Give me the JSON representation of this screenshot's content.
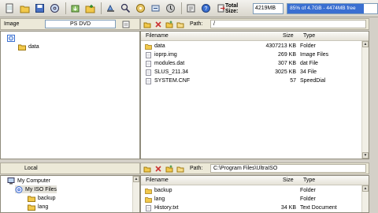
{
  "toolbar": {
    "buttons": [
      "new-icon",
      "open-icon",
      "save-icon",
      "save-as-icon",
      "extract-icon",
      "add-files-icon",
      "add-dir-icon",
      "delete-icon",
      "burn-icon",
      "mount-icon",
      "compress-icon",
      "properties-icon",
      "help-icon",
      "exit-icon"
    ],
    "total_size_label": "Total Size:",
    "total_size_value": "4219MB",
    "capacity_text": "85% of 4.7GB - 4474MB free",
    "capacity_fraction": 0.85,
    "accent_color": "#3a6fd1"
  },
  "iso_pane": {
    "image_label": "Image",
    "image_name": "PS DVD",
    "path_label": "Path:",
    "path_value": "/",
    "columns": {
      "filename": "Filename",
      "size": "Size",
      "type": "Type"
    },
    "tree": [
      {
        "label": "",
        "icon": "disc-icon"
      },
      {
        "label": "data",
        "icon": "folder-icon"
      }
    ],
    "files": [
      {
        "name": "data",
        "size": "4307213 KB",
        "type": "Folder",
        "icon": "folder-icon"
      },
      {
        "name": "ioprp.img",
        "size": "269 KB",
        "type": "Image Files",
        "icon": "file-icon"
      },
      {
        "name": "modules.dat",
        "size": "307 KB",
        "type": "dat File",
        "icon": "file-icon"
      },
      {
        "name": "SLUS_211.34",
        "size": "3025 KB",
        "type": "34 File",
        "icon": "file-icon"
      },
      {
        "name": "SYSTEM.CNF",
        "size": "57",
        "type": "SpeedDial",
        "icon": "file-icon"
      }
    ]
  },
  "local_pane": {
    "label": "Local",
    "path_label": "Path:",
    "path_value": "C:\\Program Files\\UltraISO",
    "columns": {
      "filename": "Filename",
      "size": "Size",
      "type": "Type"
    },
    "tree": [
      {
        "label": "My Computer",
        "icon": "computer-icon"
      },
      {
        "label": "My ISO Files",
        "icon": "iso-folder-icon"
      },
      {
        "label": "backup",
        "icon": "folder-icon"
      },
      {
        "label": "lang",
        "icon": "folder-icon"
      }
    ],
    "files": [
      {
        "name": "backup",
        "size": "",
        "type": "Folder",
        "icon": "folder-icon"
      },
      {
        "name": "lang",
        "size": "",
        "type": "Folder",
        "icon": "folder-icon"
      },
      {
        "name": "History.txt",
        "size": "34 KB",
        "type": "Text Document",
        "icon": "file-icon"
      }
    ]
  }
}
